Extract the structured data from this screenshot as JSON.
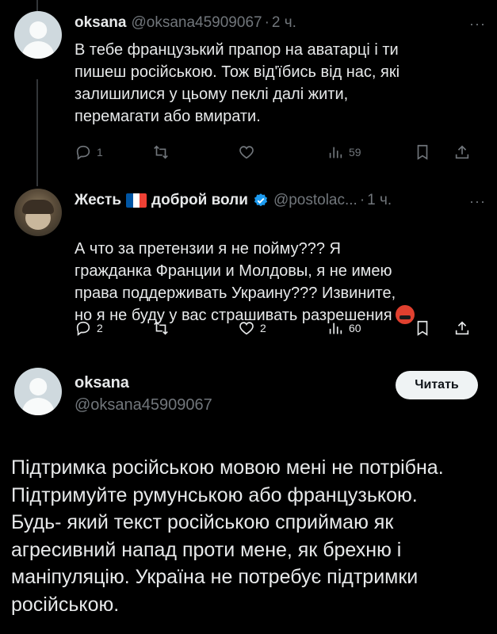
{
  "tweets": [
    {
      "name": "oksana",
      "handle": "@oksana45909067",
      "time": "2 ч.",
      "more": "···",
      "text": "В тебе французький прапор на аватарці і ти\nпишеш російською. Тож від'їбись від нас, які\nзалишилися у цьому пеклі далі жити,\nперемагати або вмирати.",
      "replies": "1",
      "retweets": "",
      "likes": "",
      "views": "59"
    },
    {
      "name_part1": "Жесть",
      "name_part2": "доброй воли",
      "handle": "@postolac...",
      "time": "1 ч.",
      "more": "···",
      "text": "А что за претензии я не пойму??? Я\nгражданка Франции и Молдовы, я не имею\nправа поддерживать Украину??? Извините,\nно я не буду у вас страшивать разрешения",
      "replies": "2",
      "retweets": "",
      "likes": "2",
      "views": "60"
    }
  ],
  "main_tweet": {
    "name": "oksana",
    "handle": "@oksana45909067",
    "follow_label": "Читать",
    "text": "Підтримка російською мовою мені не потрібна.\nПідтримуйте румунською або французькою.\nБудь- який текст російською сприймаю як\nагресивний напад проти мене, як брехню і\nманіпуляцію. Україна не потребує підтримки\nросійською."
  },
  "colors": {
    "background": "#000000",
    "text": "#e7e9ea",
    "muted": "#71767b",
    "verified": "#1d9bf0",
    "flag": [
      "#0055a4",
      "#ffffff",
      "#ef4135"
    ]
  },
  "icons": [
    "reply-icon",
    "retweet-icon",
    "like-icon",
    "views-icon",
    "bookmark-icon",
    "share-icon",
    "verified-icon",
    "french-flag-icon",
    "angry-emoji-icon"
  ]
}
